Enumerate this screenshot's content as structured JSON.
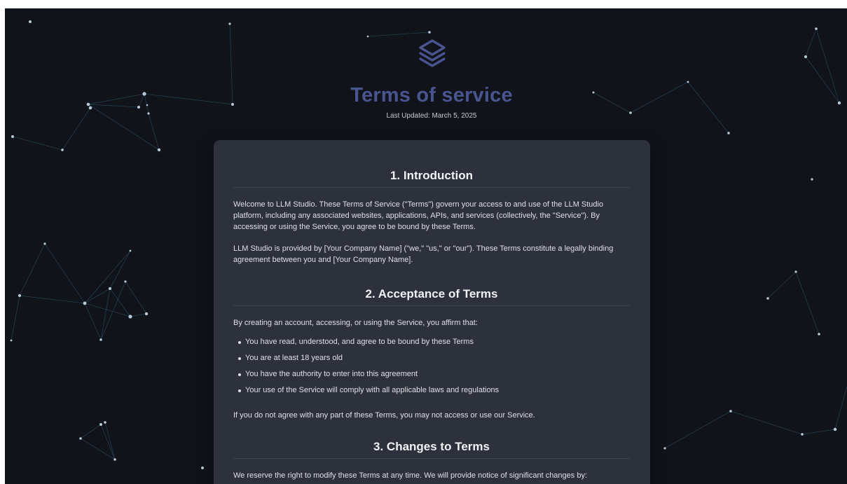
{
  "page": {
    "title": "Terms of service",
    "last_updated": "Last Updated: March 5, 2025",
    "logo_icon": "layers-icon",
    "accent_color": "#4a5590",
    "background_color": "#10131a",
    "card_color": "#2c313b"
  },
  "sections": [
    {
      "heading": "1. Introduction",
      "paragraphs": [
        "Welcome to LLM Studio. These Terms of Service (\"Terms\") govern your access to and use of the LLM Studio platform, including any associated websites, applications, APIs, and services (collectively, the \"Service\"). By accessing or using the Service, you agree to be bound by these Terms.",
        "LLM Studio is provided by [Your Company Name] (\"we,\" \"us,\" or \"our\"). These Terms constitute a legally binding agreement between you and [Your Company Name]."
      ]
    },
    {
      "heading": "2. Acceptance of Terms",
      "intro": "By creating an account, accessing, or using the Service, you affirm that:",
      "bullets": [
        "You have read, understood, and agree to be bound by these Terms",
        "You are at least 18 years old",
        "You have the authority to enter into this agreement",
        "Your use of the Service will comply with all applicable laws and regulations"
      ],
      "outro": "If you do not agree with any part of these Terms, you may not access or use our Service."
    },
    {
      "heading": "3. Changes to Terms",
      "intro": "We reserve the right to modify these Terms at any time. We will provide notice of significant changes by:"
    }
  ]
}
